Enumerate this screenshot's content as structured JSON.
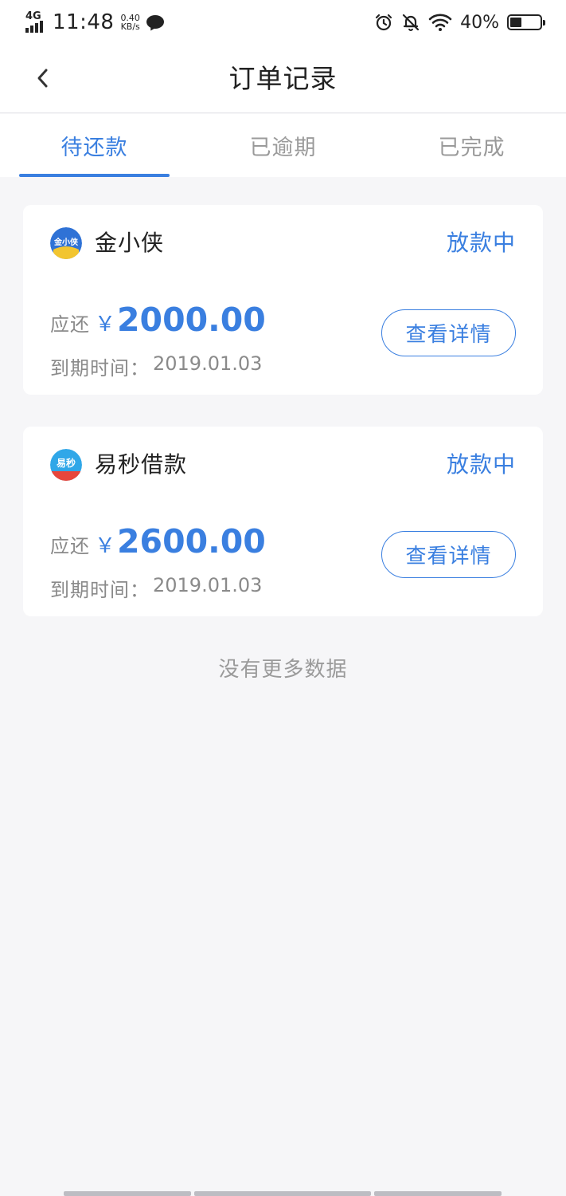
{
  "status_bar": {
    "network": "4G",
    "time": "11:48",
    "speed_value": "0.40",
    "speed_unit": "KB/s",
    "battery_percent": "40%",
    "battery_level": 0.4
  },
  "nav": {
    "title": "订单记录"
  },
  "tabs": [
    {
      "label": "待还款",
      "active": true
    },
    {
      "label": "已逾期",
      "active": false
    },
    {
      "label": "已完成",
      "active": false
    }
  ],
  "orders": [
    {
      "name": "金小侠",
      "logo_text": "金小侠",
      "status": "放款中",
      "amount_label": "应还",
      "currency": "￥",
      "amount": "2000.00",
      "due_label": "到期时间：",
      "due_date": "2019.01.03",
      "detail_label": "查看详情"
    },
    {
      "name": "易秒借款",
      "logo_text": "易秒",
      "status": "放款中",
      "amount_label": "应还",
      "currency": "￥",
      "amount": "2600.00",
      "due_label": "到期时间：",
      "due_date": "2019.01.03",
      "detail_label": "查看详情"
    }
  ],
  "footer": {
    "no_more": "没有更多数据"
  },
  "colors": {
    "accent": "#3a7fe0",
    "muted": "#8a8a8a",
    "background": "#f6f6f8"
  }
}
